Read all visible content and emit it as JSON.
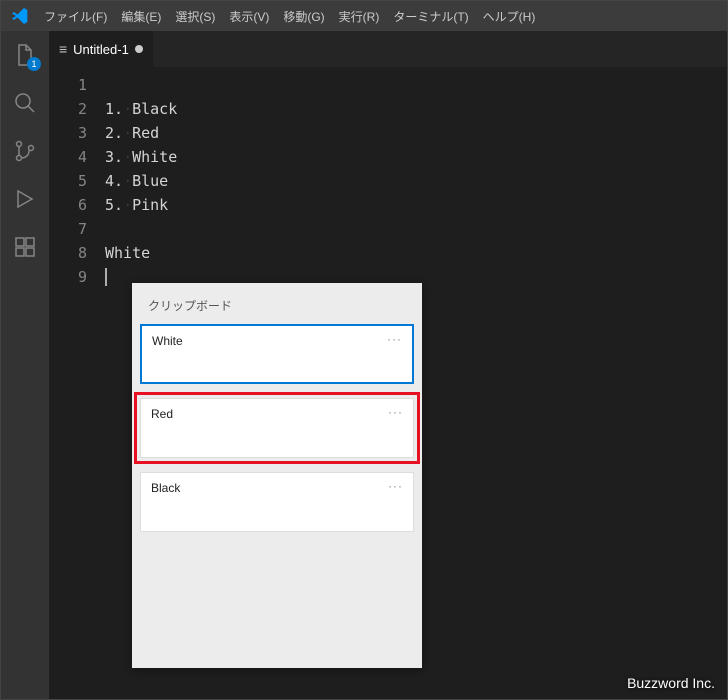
{
  "menubar": {
    "items": [
      "ファイル(F)",
      "編集(E)",
      "選択(S)",
      "表示(V)",
      "移動(G)",
      "実行(R)",
      "ターミナル(T)",
      "ヘルプ(H)"
    ]
  },
  "activitybar": {
    "explorer_badge": "1"
  },
  "tabs": {
    "active": {
      "label": "Untitled-1"
    }
  },
  "editor": {
    "lines": [
      {
        "n": "1",
        "text": ""
      },
      {
        "n": "2",
        "text": "1.·Black"
      },
      {
        "n": "3",
        "text": "2.·Red"
      },
      {
        "n": "4",
        "text": "3.·White"
      },
      {
        "n": "5",
        "text": "4.·Blue"
      },
      {
        "n": "6",
        "text": "5.·Pink"
      },
      {
        "n": "7",
        "text": ""
      },
      {
        "n": "8",
        "text": "White"
      },
      {
        "n": "9",
        "text": ""
      }
    ]
  },
  "clipboard": {
    "title": "クリップボード",
    "items": [
      {
        "text": "White",
        "selected": true,
        "highlight": false
      },
      {
        "text": "Red",
        "selected": false,
        "highlight": true
      },
      {
        "text": "Black",
        "selected": false,
        "highlight": false
      }
    ]
  },
  "watermark": "Buzzword Inc."
}
